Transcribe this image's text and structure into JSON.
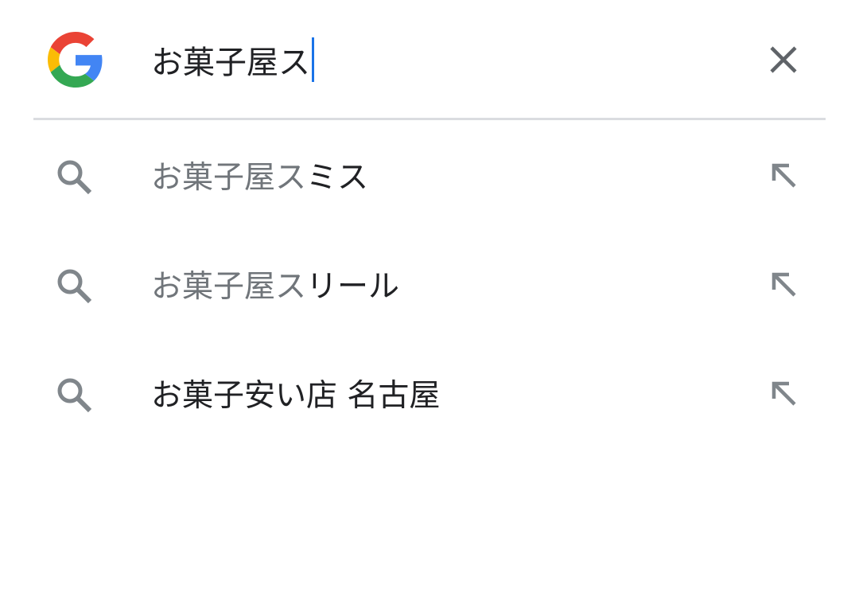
{
  "colors": {
    "text": "#202124",
    "muted_text": "#70757a",
    "icon": "#80868b",
    "caret": "#1a73e8",
    "divider": "#dadce0",
    "google_blue": "#4285F4",
    "google_red": "#EA4335",
    "google_yellow": "#FBBC05",
    "google_green": "#34A853"
  },
  "search": {
    "logo_icon": "google-g-logo",
    "query": "お菓子屋ス",
    "clear_icon": "close-icon"
  },
  "suggestions": [
    {
      "prefix": "お菓子屋ス",
      "suffix": "ミス",
      "icon": "search-icon",
      "action_icon": "arrow-up-left-icon"
    },
    {
      "prefix": "お菓子屋ス",
      "suffix": "リール",
      "icon": "search-icon",
      "action_icon": "arrow-up-left-icon"
    },
    {
      "prefix": "",
      "suffix": "お菓子安い店 名古屋",
      "icon": "search-icon",
      "action_icon": "arrow-up-left-icon"
    }
  ]
}
